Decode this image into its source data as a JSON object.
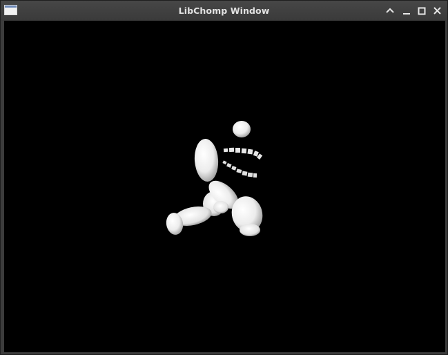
{
  "window": {
    "title": "LibChomp Window",
    "icons": {
      "app": "app-window-icon",
      "shade": "chevron-up-icon",
      "minimize": "minimize-icon",
      "maximize": "maximize-icon",
      "close": "close-icon"
    }
  },
  "scene": {
    "background": "#000000",
    "figure_color": "#f2f2f2"
  }
}
